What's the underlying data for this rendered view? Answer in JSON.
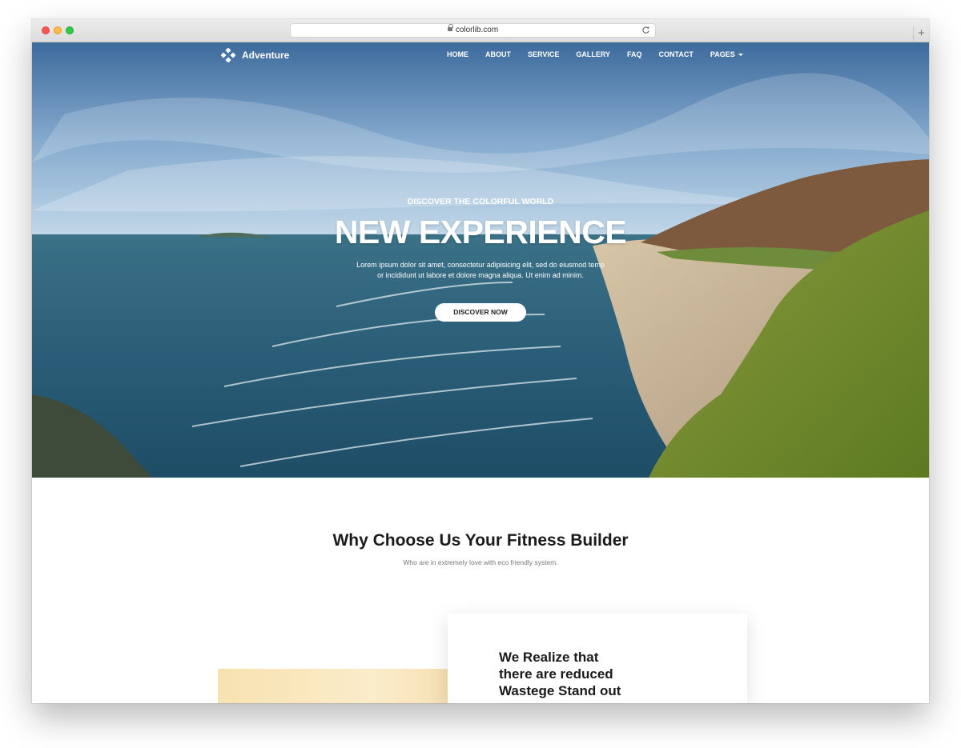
{
  "browser": {
    "url": "colorlib.com"
  },
  "nav": {
    "brand": "Adventure",
    "items": [
      {
        "label": "HOME"
      },
      {
        "label": "ABOUT"
      },
      {
        "label": "SERVICE"
      },
      {
        "label": "GALLERY"
      },
      {
        "label": "FAQ"
      },
      {
        "label": "CONTACT"
      },
      {
        "label": "PAGES"
      }
    ]
  },
  "hero": {
    "eyebrow": "DISCOVER THE COLORFUL WORLD",
    "title": "NEW EXPERIENCE",
    "text_line1": "Lorem ipsum dolor sit amet, consectetur adipisicing elit, sed do eiusmod temp",
    "text_line2": "or incididunt ut labore et dolore magna aliqua. Ut enim ad minim.",
    "button": "DISCOVER NOW"
  },
  "section": {
    "title": "Why Choose Us Your Fitness Builder",
    "subtitle": "Who are in extremely love with eco friendly system."
  },
  "feature": {
    "heading_line1": "We Realize that",
    "heading_line2": "there are reduced",
    "heading_line3": "Wastege Stand out"
  },
  "colors": {
    "traffic_red": "#fc5753",
    "traffic_yellow": "#fdbc40",
    "traffic_green": "#33c748",
    "hero_text": "#ffffff",
    "heading_text": "#1a1a1a"
  }
}
